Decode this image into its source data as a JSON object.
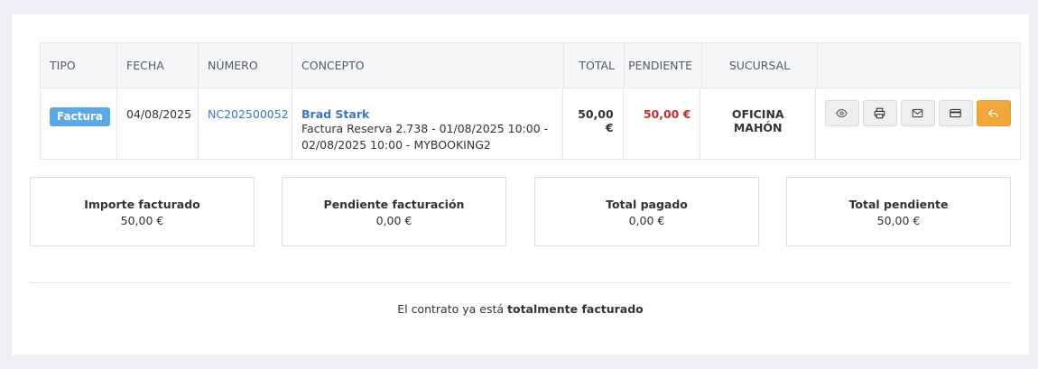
{
  "table": {
    "headers": {
      "tipo": "TIPO",
      "fecha": "FECHA",
      "numero": "NÚMERO",
      "concepto": "CONCEPTO",
      "total": "TOTAL",
      "pendiente": "PENDIENTE",
      "sucursal": "SUCURSAL"
    },
    "rows": [
      {
        "tipo": "Factura",
        "fecha": "04/08/2025",
        "numero": "NC202500052",
        "concepto_nombre": "Brad Stark",
        "concepto_detalle": "Factura Reserva 2.738 - 01/08/2025 10:00 - 02/08/2025 10:00 - MYBOOKING2",
        "total": "50,00 €",
        "pendiente": "50,00 €",
        "sucursal": "OFICINA MAHÓN"
      }
    ],
    "actions": [
      {
        "icon": "eye-icon"
      },
      {
        "icon": "print-icon"
      },
      {
        "icon": "mail-icon"
      },
      {
        "icon": "credit-card-icon"
      },
      {
        "icon": "reply-icon"
      }
    ]
  },
  "summary": {
    "importe_facturado": {
      "title": "Importe facturado",
      "value": "50,00 €"
    },
    "pendiente_facturacion": {
      "title": "Pendiente facturación",
      "value": "0,00 €"
    },
    "total_pagado": {
      "title": "Total pagado",
      "value": "0,00 €"
    },
    "total_pendiente": {
      "title": "Total pendiente",
      "value": "50,00 €"
    }
  },
  "footer": {
    "prefix": "El contrato ya está ",
    "bold": "totalmente facturado"
  },
  "colors": {
    "badge": "#5aa9e6",
    "link": "#3a78c2",
    "negative": "#c9302c",
    "positive": "#2ca84e",
    "accent_button": "#f2a73d"
  }
}
